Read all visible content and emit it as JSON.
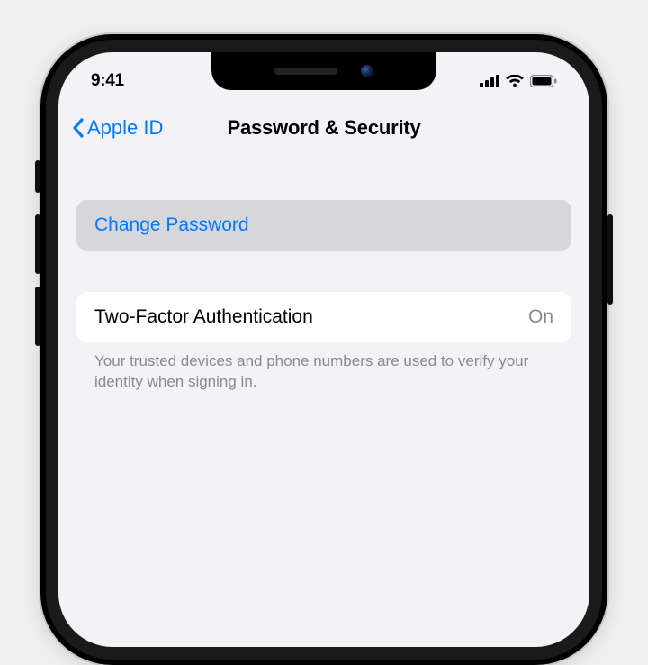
{
  "status": {
    "time": "9:41"
  },
  "nav": {
    "back_label": "Apple ID",
    "title": "Password & Security"
  },
  "rows": {
    "change_password": "Change Password",
    "two_factor_label": "Two-Factor Authentication",
    "two_factor_status": "On",
    "two_factor_footer": "Your trusted devices and phone numbers are used to verify your identity when signing in."
  }
}
